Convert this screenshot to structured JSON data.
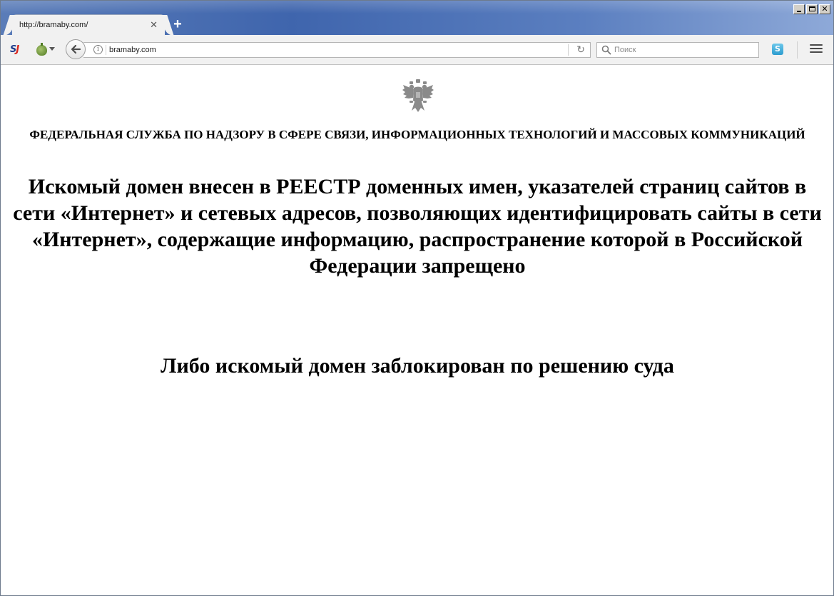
{
  "window": {
    "controls": [
      "minimize",
      "maximize",
      "close"
    ]
  },
  "tabs": [
    {
      "title": "http://bramaby.com/",
      "active": true
    }
  ],
  "toolbar": {
    "url": "bramaby.com",
    "search_placeholder": "Поиск",
    "icons": [
      "sj-extension-icon",
      "onion-icon",
      "back-icon",
      "info-icon",
      "reload-icon",
      "search-icon",
      "skype-icon",
      "hamburger-menu-icon"
    ]
  },
  "page": {
    "emblem": "russian-coat-of-arms",
    "agency_name": "ФЕДЕРАЛЬНАЯ СЛУЖБА ПО НАДЗОРУ В СФЕРЕ СВЯЗИ, ИНФОРМАЦИОННЫХ ТЕХНОЛОГИЙ И МАССОВЫХ КОММУНИКАЦИЙ",
    "main_notice": "Искомый домен внесен в РЕЕСТР доменных имен, указателей страниц сайтов в сети «Интернет» и сетевых адресов, позволяющих идентифицировать сайты в сети «Интернет», содержащие информацию, распространение которой в Российской Федерации запрещено",
    "court_notice": "Либо искомый домен заблокирован по решению суда"
  },
  "colors": {
    "titlebar": "#3f65ad",
    "toolbar": "#f1f1f1",
    "emblem": "#8a8a8a"
  }
}
